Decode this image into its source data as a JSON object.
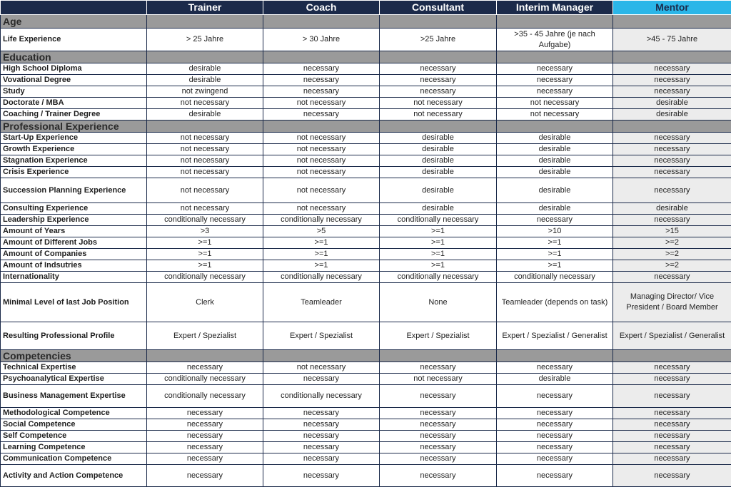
{
  "header": {
    "c0": "",
    "c1": "Trainer",
    "c2": "Coach",
    "c3": "Consultant",
    "c4": "Interim Manager",
    "c5": "Mentor"
  },
  "sections": {
    "age": "Age",
    "education": "Education",
    "professional": "Professional Experience",
    "competencies": "Competencies"
  },
  "rows": {
    "life_experience": [
      "Life Experience",
      "> 25 Jahre",
      "> 30 Jahre",
      ">25 Jahre",
      ">35 - 45 Jahre (je nach Aufgabe)",
      ">45 - 75 Jahre"
    ],
    "high_school": [
      "High School Diploma",
      "desirable",
      "necessary",
      "necessary",
      "necessary",
      "necessary"
    ],
    "vocational": [
      "Vovational Degree",
      "desirable",
      "necessary",
      "necessary",
      "necessary",
      "necessary"
    ],
    "study": [
      "Study",
      "not zwingend",
      "necessary",
      "necessary",
      "necessary",
      "necessary"
    ],
    "doctorate": [
      "Doctorate / MBA",
      "not necessary",
      "not necessary",
      "not necessary",
      "not necessary",
      "desirable"
    ],
    "coaching_degree": [
      "Coaching / Trainer Degree",
      "desirable",
      "necessary",
      "not necessary",
      "not necessary",
      "desirable"
    ],
    "startup": [
      "Start-Up Experience",
      "not necessary",
      "not necessary",
      "desirable",
      "desirable",
      "necessary"
    ],
    "growth": [
      "Growth Experience",
      "not necessary",
      "not necessary",
      "desirable",
      "desirable",
      "necessary"
    ],
    "stagnation": [
      "Stagnation Experience",
      "not necessary",
      "not necessary",
      "desirable",
      "desirable",
      "necessary"
    ],
    "crisis": [
      "Crisis Experience",
      "not necessary",
      "not necessary",
      "desirable",
      "desirable",
      "necessary"
    ],
    "succession": [
      "Succession Planning Experience",
      "not necessary",
      "not necessary",
      "desirable",
      "desirable",
      "necessary"
    ],
    "consulting": [
      "Consulting Experience",
      "not necessary",
      "not necessary",
      "desirable",
      "desirable",
      "desirable"
    ],
    "leadership": [
      "Leadership Experience",
      "conditionally necessary",
      "conditionally necessary",
      "conditionally necessary",
      "necessary",
      "necessary"
    ],
    "years": [
      "Amount of Years",
      ">3",
      ">5",
      ">=1",
      ">10",
      ">15"
    ],
    "jobs": [
      "Amount of Different Jobs",
      ">=1",
      ">=1",
      ">=1",
      ">=1",
      ">=2"
    ],
    "companies": [
      "Amount of Companies",
      ">=1",
      ">=1",
      ">=1",
      ">=1",
      ">=2"
    ],
    "industries": [
      "Amount of Indsutries",
      ">=1",
      ">=1",
      ">=1",
      ">=1",
      ">=2"
    ],
    "internationality": [
      "Internationality",
      "conditionally necessary",
      "conditionally necessary",
      "conditionally necessary",
      "conditionally necessary",
      "necessary"
    ],
    "min_level": [
      "Minimal Level of last Job Position",
      "Clerk",
      "Teamleader",
      "None",
      "Teamleader (depends on task)",
      "Managing Director/ Vice President / Board Member"
    ],
    "profile": [
      "Resulting Professional Profile",
      "Expert / Spezialist",
      "Expert / Spezialist",
      "Expert / Spezialist",
      "Expert / Spezialist / Generalist",
      "Expert / Spezialist / Generalist"
    ],
    "technical": [
      "Technical Expertise",
      "necessary",
      "not necessary",
      "necessary",
      "necessary",
      "necessary"
    ],
    "psycho": [
      "Psychoanalytical Expertise",
      "conditionally necessary",
      "necessary",
      "not necessary",
      "desirable",
      "necessary"
    ],
    "business": [
      "Business Management Expertise",
      "conditionally necessary",
      "conditionally necessary",
      "necessary",
      "necessary",
      "necessary"
    ],
    "methodological": [
      "Methodological Competence",
      "necessary",
      "necessary",
      "necessary",
      "necessary",
      "necessary"
    ],
    "social": [
      "Social Competence",
      "necessary",
      "necessary",
      "necessary",
      "necessary",
      "necessary"
    ],
    "self": [
      "Self Competence",
      "necessary",
      "necessary",
      "necessary",
      "necessary",
      "necessary"
    ],
    "learning": [
      "Learning Competence",
      "necessary",
      "necessary",
      "necessary",
      "necessary",
      "necessary"
    ],
    "communication": [
      "Communication Competence",
      "necessary",
      "necessary",
      "necessary",
      "necessary",
      "necessary"
    ],
    "activity": [
      "Activity and Action Competence",
      "necessary",
      "necessary",
      "necessary",
      "necessary",
      "necessary"
    ]
  },
  "colors": {
    "header_bg": "#1b2a4a",
    "mentor_header_bg": "#2bb6e8",
    "section_bg": "#9a9a9a",
    "mentor_column_bg": "#ececec"
  }
}
